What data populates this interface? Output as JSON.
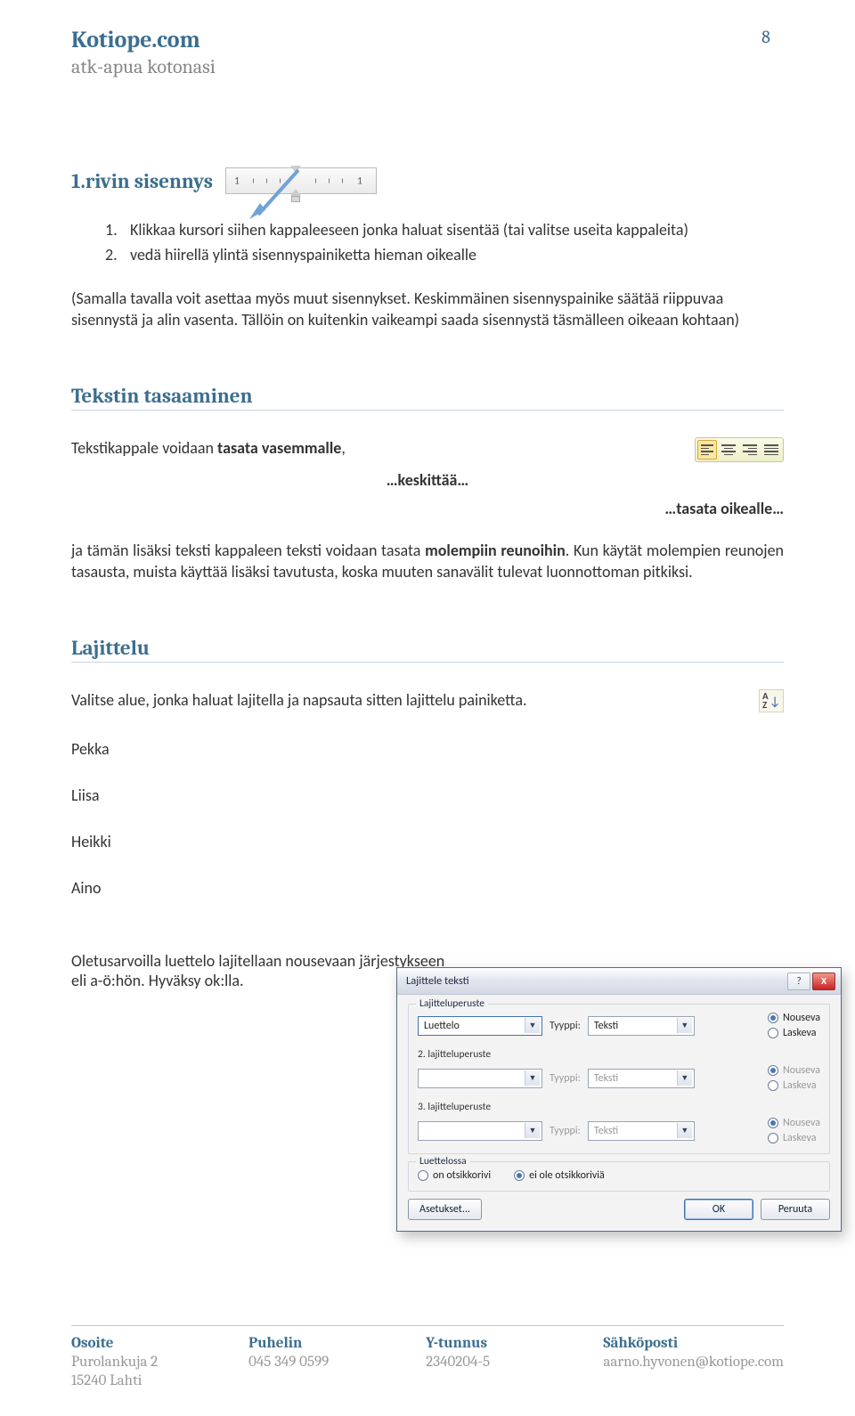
{
  "header": {
    "site_title": "Kotiope.com",
    "site_subtitle": "atk-apua kotonasi",
    "page_number": "8"
  },
  "section1": {
    "title": "1.rivin sisennys",
    "ruler": {
      "num_left": "1",
      "num_right": "1"
    },
    "steps": [
      {
        "num": "1.",
        "text": "Klikkaa kursori siihen kappaleeseen jonka haluat sisentää (tai valitse useita kappaleita)"
      },
      {
        "num": "2.",
        "text": "vedä hiirellä ylintä sisennyspainiketta hieman oikealle"
      }
    ],
    "para": "(Samalla tavalla voit asettaa myös muut sisennykset. Keskimmäinen sisennyspainike säätää riippuvaa sisennystä ja alin vasenta. Tällöin on kuitenkin vaikeampi saada sisennystä täsmälleen oikeaan kohtaan)"
  },
  "section2": {
    "title": "Tekstin tasaaminen",
    "left_text_prefix": "Tekstikappale voidaan ",
    "left_text_bold": "tasata vasemmalle",
    "left_text_suffix": ",",
    "center_text": "…keskittää…",
    "right_text": "…tasata oikealle…",
    "para_parts": {
      "a": "ja tämän lisäksi teksti kappaleen teksti voidaan tasata ",
      "b": "molempiin reunoihin",
      "c": ". Kun käytät molempien reunojen tasausta, muista käyttää lisäksi tavutusta,  koska muuten sanavälit tulevat luonnottoman pitkiksi."
    }
  },
  "section3": {
    "title": "Lajittelu",
    "intro": "Valitse alue, jonka haluat lajitella ja napsauta sitten lajittelu painiketta.",
    "names": [
      "Pekka",
      "Liisa",
      "Heikki",
      "Aino"
    ],
    "after": "Oletusarvoilla luettelo lajitellaan nousevaan järjestykseen\neli a-ö:hön. Hyväksy ok:lla.",
    "sort_icon": {
      "a": "A",
      "z": "Z",
      "arrow": "↓"
    }
  },
  "dialog": {
    "title": "Lajittele teksti",
    "help": "?",
    "close": "X",
    "fieldset1": {
      "legend": "Lajitteluperuste",
      "primary_value": "Luettelo",
      "sub2_label": "2. lajitteluperuste",
      "sub3_label": "3. lajitteluperuste",
      "type_label": "Tyyppi:",
      "type_value": "Teksti",
      "radio_asc": "Nouseva",
      "radio_desc": "Laskeva"
    },
    "fieldset2": {
      "legend": "Luettelossa",
      "opt1": "on otsikkorivi",
      "opt2": "ei ole otsikkoriviä"
    },
    "buttons": {
      "settings": "Asetukset...",
      "ok": "OK",
      "cancel": "Peruuta"
    }
  },
  "footer": {
    "cols": [
      {
        "hd": "Osoite",
        "l1": "Purolankuja 2",
        "l2": "15240 Lahti"
      },
      {
        "hd": "Puhelin",
        "l1": "045 349 0599",
        "l2": ""
      },
      {
        "hd": "Y-tunnus",
        "l1": "2340204-5",
        "l2": ""
      },
      {
        "hd": "Sähköposti",
        "l1": "aarno.hyvonen@kotiope.com",
        "l2": ""
      }
    ]
  }
}
